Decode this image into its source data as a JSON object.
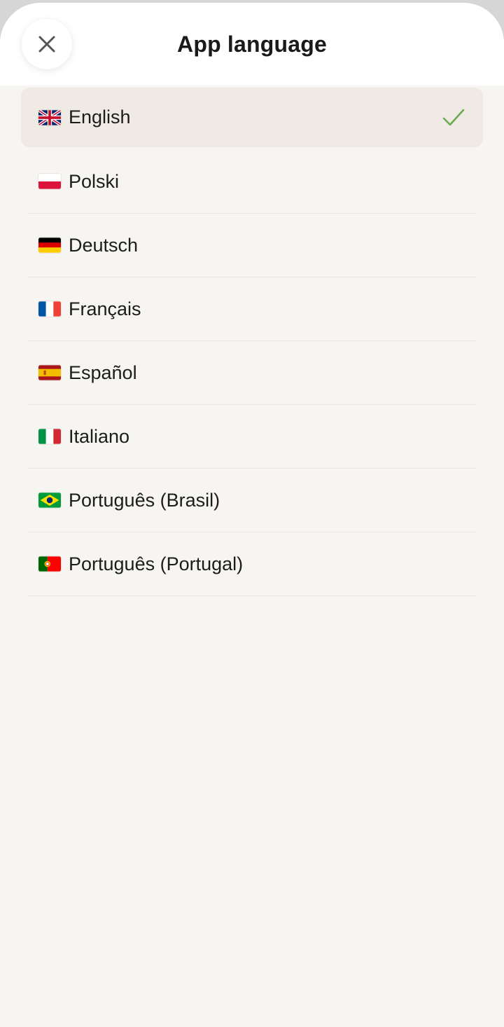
{
  "header": {
    "title": "App language",
    "close_icon": "close-icon"
  },
  "languages": [
    {
      "label": "English",
      "flag": "gb-flag-icon",
      "selected": true
    },
    {
      "label": "Polski",
      "flag": "pl-flag-icon",
      "selected": false
    },
    {
      "label": "Deutsch",
      "flag": "de-flag-icon",
      "selected": false
    },
    {
      "label": "Français",
      "flag": "fr-flag-icon",
      "selected": false
    },
    {
      "label": "Español",
      "flag": "es-flag-icon",
      "selected": false
    },
    {
      "label": "Italiano",
      "flag": "it-flag-icon",
      "selected": false
    },
    {
      "label": "Português (Brasil)",
      "flag": "br-flag-icon",
      "selected": false
    },
    {
      "label": "Português (Portugal)",
      "flag": "pt-flag-icon",
      "selected": false
    }
  ],
  "colors": {
    "accent_check": "#6aa84f",
    "selected_row_bg": "#efebe4",
    "background": "#f7f5f1"
  }
}
